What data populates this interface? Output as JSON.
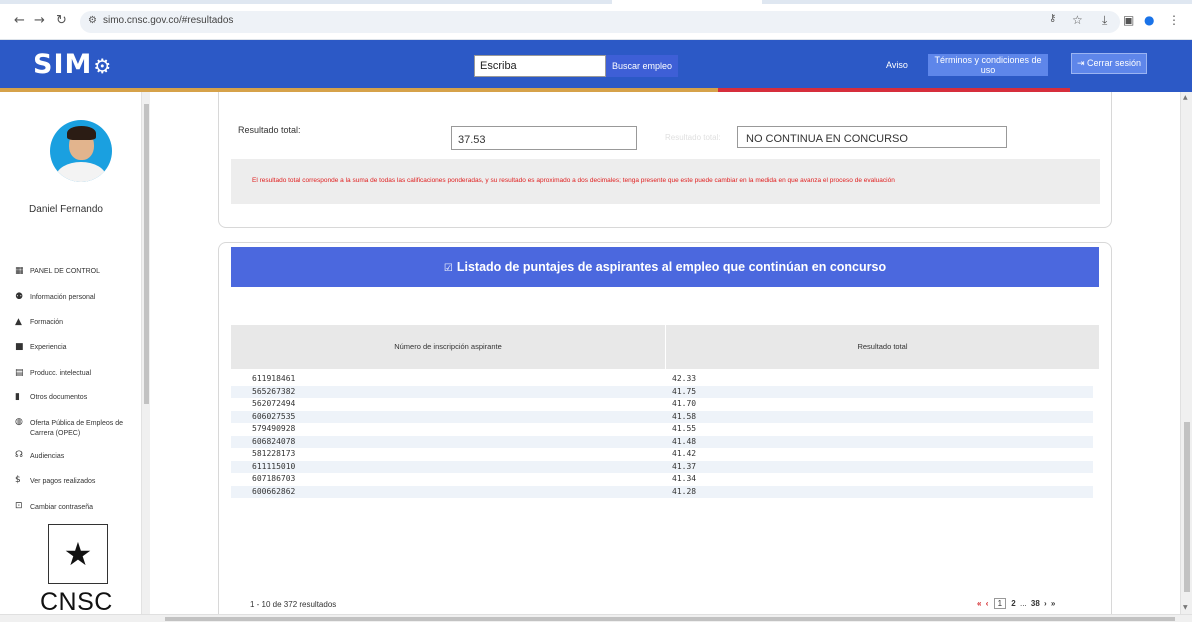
{
  "browser": {
    "url": "simo.cnsc.gov.co/#resultados"
  },
  "header": {
    "logo_text": "SIM",
    "search_value": "Escriba",
    "search_button": "Buscar empleo",
    "aviso": "Aviso",
    "terms_button": "Términos y condiciones de uso",
    "logout_button": "Cerrar sesión",
    "colors": {
      "bar": "#2c59c6",
      "stripe_left": "#d6a24a",
      "stripe_right": "#d62e3c"
    }
  },
  "sidebar": {
    "user_name": "Daniel Fernando",
    "items": [
      {
        "label": "PANEL DE CONTROL",
        "icon": "dashboard-icon"
      },
      {
        "label": "Información personal",
        "icon": "people-icon"
      },
      {
        "label": "Formación",
        "icon": "graduation-icon"
      },
      {
        "label": "Experiencia",
        "icon": "briefcase-icon"
      },
      {
        "label": "Producc. intelectual",
        "icon": "book-icon"
      },
      {
        "label": "Otros documentos",
        "icon": "document-icon"
      },
      {
        "label": "Oferta Pública de Empleos de Carrera (OPEC)",
        "icon": "globe-icon"
      },
      {
        "label": "Audiencias",
        "icon": "audience-icon"
      },
      {
        "label": "Ver pagos realizados",
        "icon": "dollar-icon"
      },
      {
        "label": "Cambiar contraseña",
        "icon": "lock-icon"
      }
    ],
    "brand": "CNSC"
  },
  "result": {
    "total_label": "Resultado total:",
    "total_value": "37.53",
    "status_label": "Resultado total:",
    "status_value": "NO CONTINUA EN CONCURSO",
    "note": "El resultado total corresponde a la suma de todas las calificaciones ponderadas, y su resultado es aproximado a dos decimales; tenga presente que este puede cambiar en la medida en que avanza el proceso de evaluación"
  },
  "listing": {
    "title": "Listado de puntajes de aspirantes al empleo que continúan en concurso",
    "columns": [
      "Número de inscripción aspirante",
      "Resultado total"
    ],
    "rows": [
      [
        "611918461",
        "42.33"
      ],
      [
        "565267382",
        "41.75"
      ],
      [
        "562072494",
        "41.70"
      ],
      [
        "606027535",
        "41.58"
      ],
      [
        "579490928",
        "41.55"
      ],
      [
        "606824078",
        "41.48"
      ],
      [
        "581228173",
        "41.42"
      ],
      [
        "611115010",
        "41.37"
      ],
      [
        "607186703",
        "41.34"
      ],
      [
        "600662862",
        "41.28"
      ]
    ],
    "results_count": "1 - 10 de 372 resultados",
    "pager": {
      "first": "«",
      "prev": "‹",
      "current": "1",
      "next_page": "2",
      "ellipsis": "...",
      "last_page": "38",
      "next": "›",
      "last": "»"
    }
  }
}
